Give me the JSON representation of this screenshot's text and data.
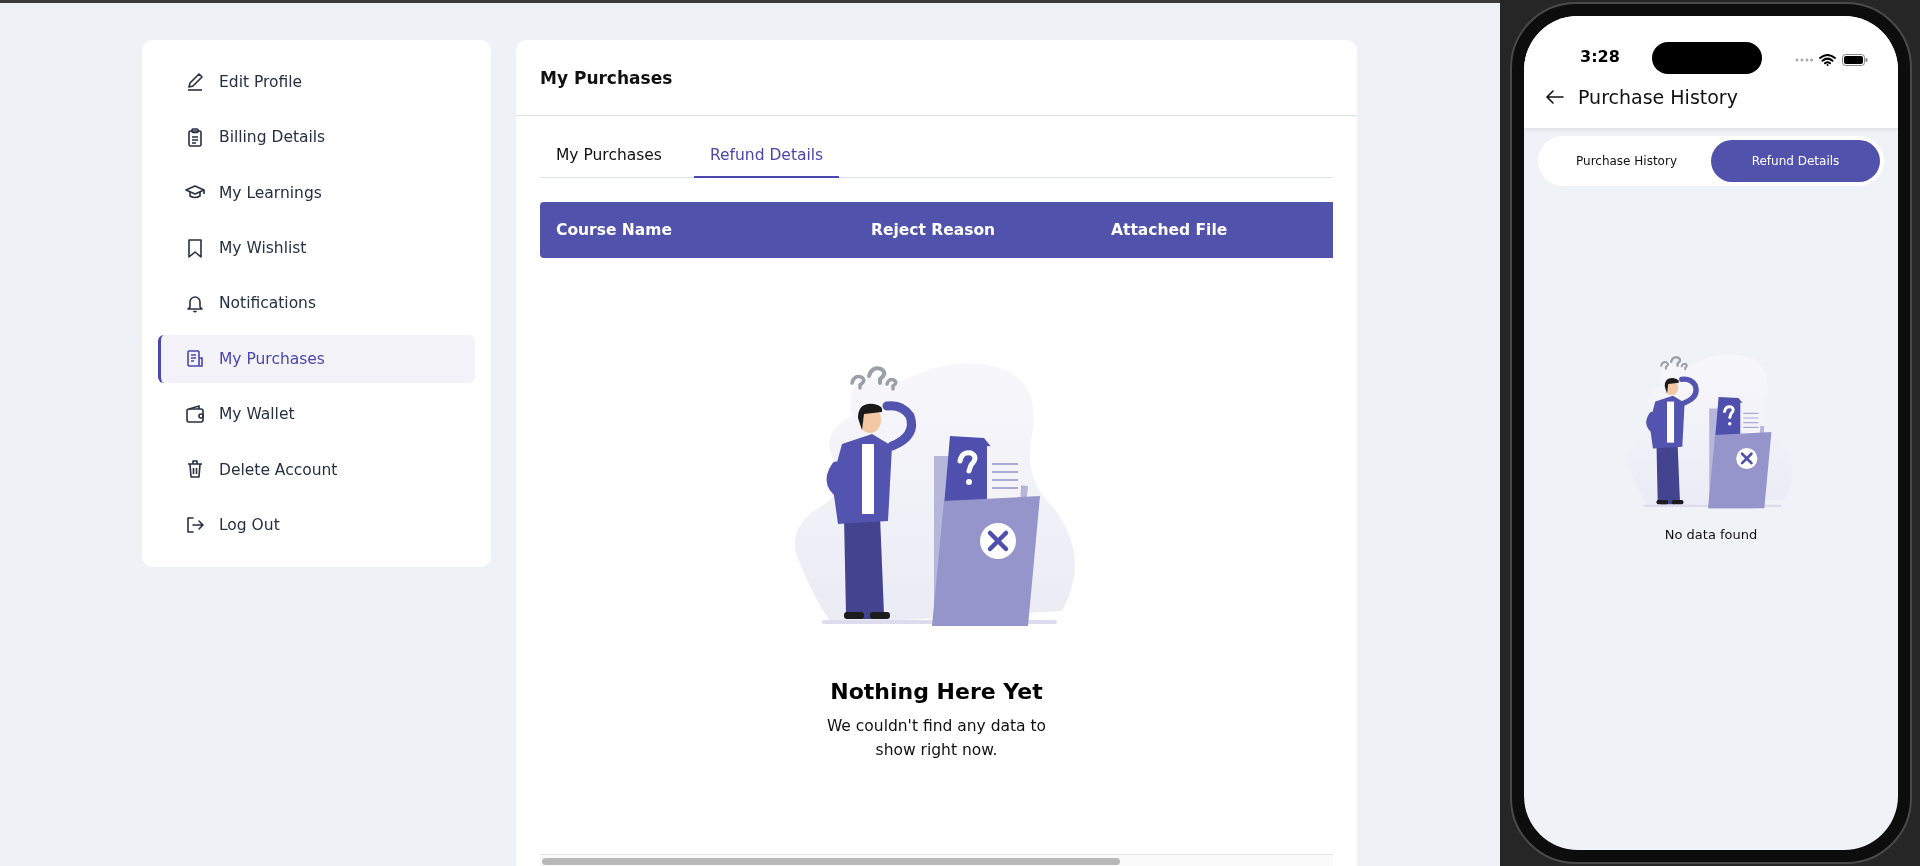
{
  "sidebar": {
    "items": [
      {
        "label": "Edit Profile",
        "selected": false
      },
      {
        "label": "Billing Details",
        "selected": false
      },
      {
        "label": "My Learnings",
        "selected": false
      },
      {
        "label": "My Wishlist",
        "selected": false
      },
      {
        "label": "Notifications",
        "selected": false
      },
      {
        "label": "My Purchases",
        "selected": true
      },
      {
        "label": "My Wallet",
        "selected": false
      },
      {
        "label": "Delete Account",
        "selected": false
      },
      {
        "label": "Log Out",
        "selected": false
      }
    ]
  },
  "main": {
    "title": "My Purchases",
    "tabs": [
      {
        "label": "My Purchases",
        "selected": false
      },
      {
        "label": "Refund Details",
        "selected": true
      }
    ],
    "table": {
      "columns": [
        "Course Name",
        "Reject Reason",
        "Attached File"
      ]
    },
    "empty_state": {
      "title": "Nothing Here Yet",
      "message": "We couldn't find any data to show right now."
    }
  },
  "phone": {
    "status_bar": {
      "time": "3:28"
    },
    "app_bar": {
      "title": "Purchase History"
    },
    "tabs": [
      {
        "label": "Purchase History",
        "selected": false
      },
      {
        "label": "Refund Details",
        "selected": true
      }
    ],
    "empty_message": "No data found"
  }
}
